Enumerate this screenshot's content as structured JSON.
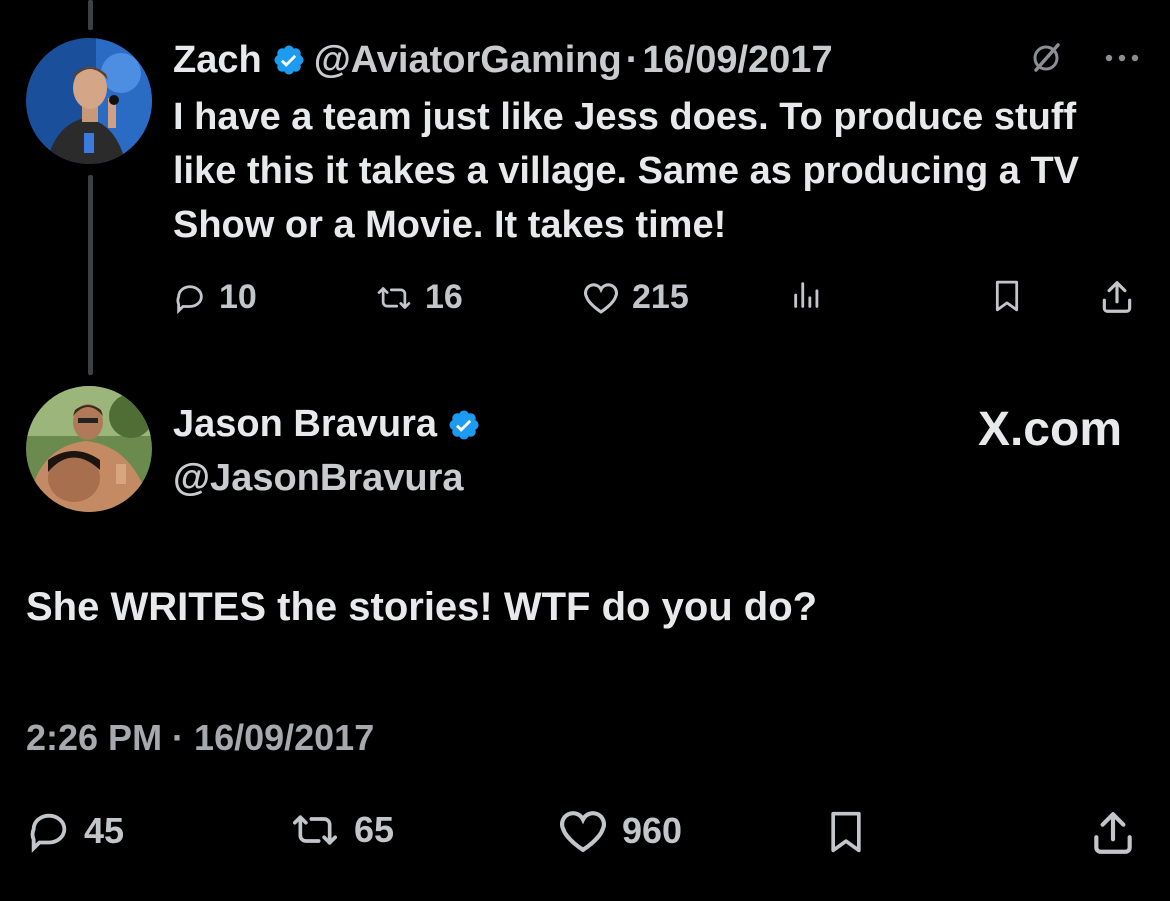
{
  "reply_tweet": {
    "author_name": "Zach",
    "handle": "@AviatorGaming",
    "separator": "·",
    "date": "16/09/2017",
    "text": "I have a team just like Jess does. To produce stuff like this it takes a village. Same as producing a TV Show or a Movie. It takes time!",
    "replies": "10",
    "reposts": "16",
    "likes": "215",
    "icons": [
      "grok-icon",
      "more-icon",
      "reply-icon",
      "repost-icon",
      "like-icon",
      "views-icon",
      "bookmark-icon",
      "share-icon"
    ]
  },
  "main_tweet": {
    "author_name": "Jason Bravura",
    "handle": "@JasonBravura",
    "site_label": "X.com",
    "text": "She WRITES the stories! WTF do you do?",
    "timestamp": "2:26 PM · 16/09/2017",
    "replies": "45",
    "reposts": "65",
    "likes": "960",
    "icons": [
      "reply-icon",
      "repost-icon",
      "like-icon",
      "bookmark-icon",
      "share-icon"
    ]
  },
  "colors": {
    "background": "#000000",
    "text": "#e7e9ea",
    "secondary": "#c2c5c9",
    "verified": "#1d9bf0",
    "thread_line": "#3e4144"
  }
}
